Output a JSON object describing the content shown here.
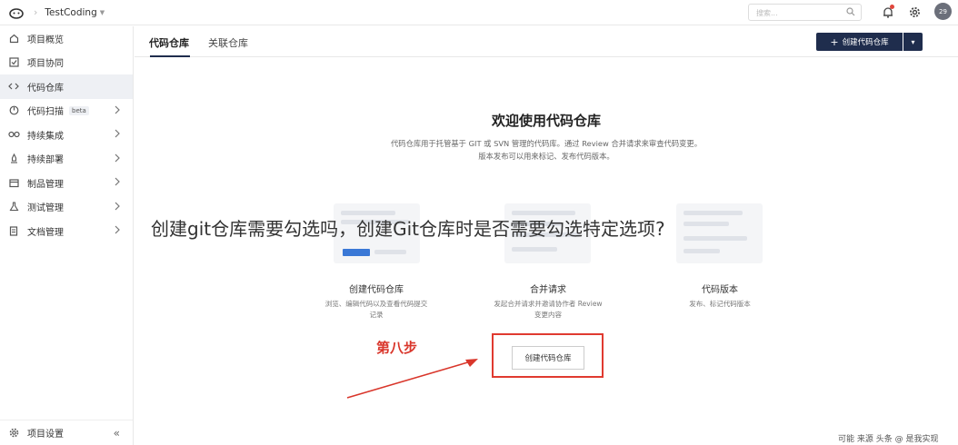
{
  "topbar": {
    "project_name": "TestCoding",
    "search_placeholder": "搜索...",
    "avatar_text": "29"
  },
  "sidebar": {
    "items": [
      {
        "label": "项目概览",
        "icon": "home-icon"
      },
      {
        "label": "项目协同",
        "icon": "checkbox-icon"
      },
      {
        "label": "代码仓库",
        "icon": "code-icon"
      },
      {
        "label": "代码扫描",
        "icon": "scan-icon",
        "badge": "beta"
      },
      {
        "label": "持续集成",
        "icon": "infinity-icon"
      },
      {
        "label": "持续部署",
        "icon": "rocket-icon"
      },
      {
        "label": "制品管理",
        "icon": "box-icon"
      },
      {
        "label": "测试管理",
        "icon": "flask-icon"
      },
      {
        "label": "文档管理",
        "icon": "doc-icon"
      }
    ],
    "bottom_label": "项目设置",
    "collapse_glyph": "«"
  },
  "tabs": [
    {
      "label": "代码仓库"
    },
    {
      "label": "关联仓库"
    }
  ],
  "create_button": {
    "label": "创建代码仓库",
    "dropdown_glyph": "▾"
  },
  "welcome": {
    "title": "欢迎使用代码仓库",
    "desc_line1": "代码仓库用于托管基于 GIT 或 SVN 管理的代码库。通过 Review 合并请求来审查代码变更。",
    "desc_line2": "版本发布可以用来标记、发布代码版本。"
  },
  "cards": [
    {
      "title": "创建代码仓库",
      "desc_line1": "浏览、编辑代码以及查看代码提交",
      "desc_line2": "记录"
    },
    {
      "title": "合并请求",
      "desc_line1": "发起合并请求并邀请协作者 Review",
      "desc_line2": "变更内容"
    },
    {
      "title": "代码版本",
      "desc_line1": "发布、标记代码版本",
      "desc_line2": ""
    }
  ],
  "annotation": {
    "step_label": "第八步",
    "button_label": "创建代码仓库",
    "color": "#e03a30"
  },
  "overlay_caption": "创建git仓库需要勾选吗，创建Git仓库时是否需要勾选特定选项?",
  "watermark": "可能 来源 头条 @ 是我实现",
  "colors": {
    "primary": "#1f2d4d",
    "active_bg": "#eef0f4",
    "accent_blue": "#3a78d6"
  }
}
